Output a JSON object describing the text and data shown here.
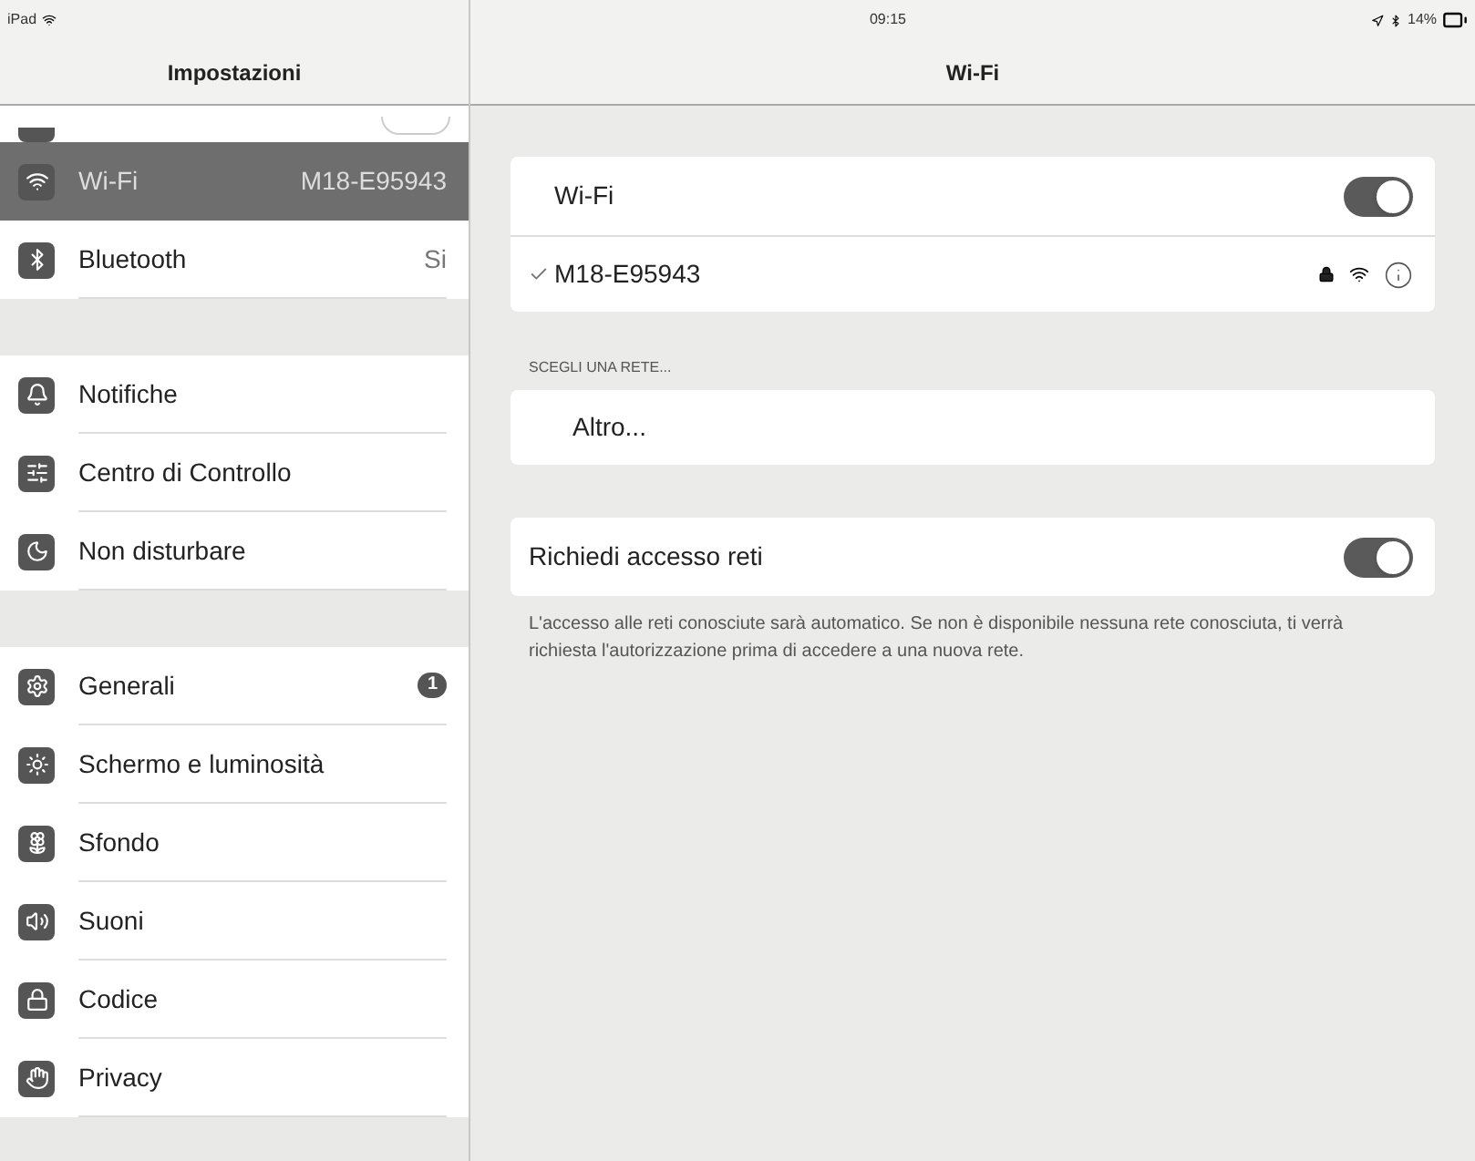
{
  "status_bar": {
    "device": "iPad",
    "time": "09:15",
    "battery": "14%"
  },
  "sidebar": {
    "title": "Impostazioni",
    "partial_row": {
      "on": false
    },
    "groups": [
      {
        "items": [
          {
            "label": "Wi-Fi",
            "value": "M18-E95943",
            "selected": true
          },
          {
            "label": "Bluetooth",
            "value": "Si",
            "selected": false
          }
        ]
      },
      {
        "items": [
          {
            "label": "Notifiche",
            "selected": false
          },
          {
            "label": "Centro di Controllo",
            "selected": false
          },
          {
            "label": "Non disturbare",
            "selected": false
          }
        ]
      },
      {
        "items": [
          {
            "label": "Generali",
            "badge": "1",
            "selected": false
          },
          {
            "label": "Schermo e luminosità",
            "selected": false
          },
          {
            "label": "Sfondo",
            "selected": false
          },
          {
            "label": "Suoni",
            "selected": false
          },
          {
            "label": "Codice",
            "selected": false
          },
          {
            "label": "Privacy",
            "selected": false
          }
        ]
      }
    ]
  },
  "detail": {
    "title": "Wi-Fi",
    "wifi_toggle": {
      "label": "Wi-Fi",
      "on": true
    },
    "connected_network": {
      "name": "M18-E95943",
      "checked": true
    },
    "section_header": "SCEGLI UNA RETE...",
    "other": "Altro...",
    "ask_toggle": {
      "label": "Richiedi accesso reti",
      "on": true
    },
    "footnote": "L'accesso alle reti conosciute sarà automatico. Se non è disponibile nessuna rete conosciuta, ti verrà richiesta l'autorizzazione prima di accedere a una nuova rete."
  }
}
